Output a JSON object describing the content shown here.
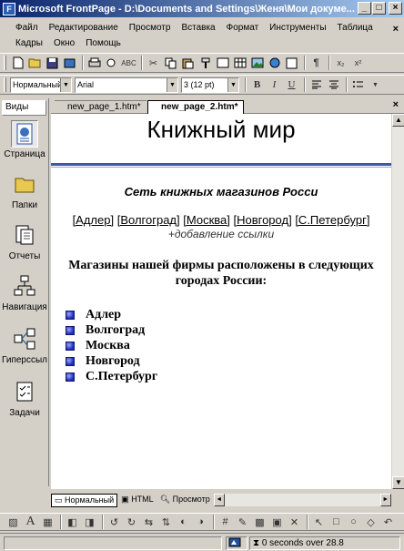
{
  "window": {
    "title": "Microsoft FrontPage - D:\\Documents and Settings\\Женя\\Мои докуме...",
    "minimize": "_",
    "maximize": "□",
    "close": "×"
  },
  "menu": {
    "row1": [
      "Файл",
      "Редактирование",
      "Просмотр",
      "Вставка",
      "Формат",
      "Инструменты",
      "Таблица"
    ],
    "row2": [
      "Кадры",
      "Окно",
      "Помощь"
    ],
    "close": "×"
  },
  "format_toolbar": {
    "style": "Нормальный",
    "font": "Arial",
    "size": "3 (12 pt)",
    "bold": "B",
    "italic": "I",
    "underline": "U"
  },
  "views": {
    "header": "Виды",
    "items": [
      {
        "label": "Страница",
        "icon": "page-view-icon"
      },
      {
        "label": "Папки",
        "icon": "folders-icon"
      },
      {
        "label": "Отчеты",
        "icon": "reports-icon"
      },
      {
        "label": "Навигация",
        "icon": "navigation-icon"
      },
      {
        "label": "Гиперссылки",
        "icon": "hyperlinks-icon"
      },
      {
        "label": "Задачи",
        "icon": "tasks-icon"
      }
    ]
  },
  "doc_tabs": [
    "new_page_1.htm*",
    "new_page_2.htm*"
  ],
  "page": {
    "title": "Книжный мир",
    "subtitle": "Сеть книжных магазинов Росси",
    "nav_links": [
      "[Адлер]",
      "[Волгоград]",
      "[Москва]",
      "[Новгород]",
      "[С.Петербург]"
    ],
    "add_link": "+добавление ссылки",
    "intro": "Магазины нашей фирмы расположены в следующих городах России:",
    "cities": [
      "Адлер",
      "Волгоград",
      "Москва",
      "Новгород",
      "С.Петербург"
    ]
  },
  "view_tabs": [
    "Нормальный",
    "HTML",
    "Просмотр"
  ],
  "status": {
    "load_time": "0 seconds over 28.8"
  },
  "colors": {
    "title_bar_start": "#0a246a",
    "title_bar_end": "#a6caf0",
    "hr_blue": "#3a5aa8",
    "bullet": "#1a2ab0"
  }
}
